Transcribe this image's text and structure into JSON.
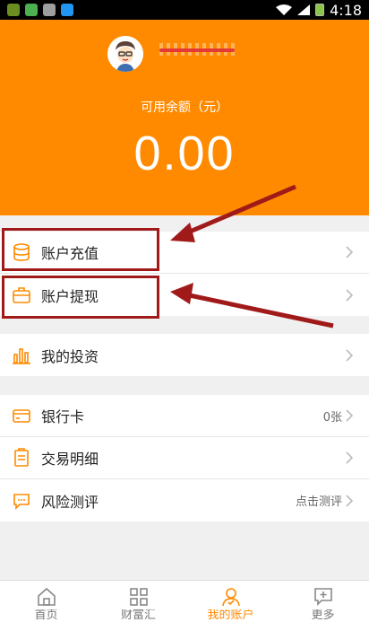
{
  "status_bar": {
    "time": "4:18"
  },
  "header": {
    "balance_label": "可用余额（元）",
    "balance_amount": "0.00"
  },
  "colors": {
    "accent": "#ff8a00",
    "callout": "#a11a1a"
  },
  "account_actions": [
    {
      "label": "账户充值",
      "icon": "database-icon"
    },
    {
      "label": "账户提现",
      "icon": "briefcase-icon"
    }
  ],
  "investments": {
    "label": "我的投资",
    "icon": "bar-chart-icon"
  },
  "details": [
    {
      "label": "银行卡",
      "value": "0张",
      "icon": "bank-card-icon"
    },
    {
      "label": "交易明细",
      "value": "",
      "icon": "receipt-icon"
    },
    {
      "label": "风险测评",
      "value": "点击测评",
      "icon": "chat-bubble-icon"
    }
  ],
  "bottom_nav": [
    {
      "label": "首页",
      "icon": "home-icon",
      "active": false
    },
    {
      "label": "财富汇",
      "icon": "grid-icon",
      "active": false
    },
    {
      "label": "我的账户",
      "icon": "user-icon",
      "active": true
    },
    {
      "label": "更多",
      "icon": "message-plus-icon",
      "active": false
    }
  ]
}
